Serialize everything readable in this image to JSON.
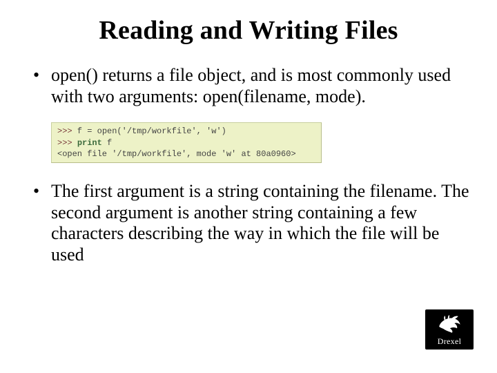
{
  "title": "Reading and Writing Files",
  "bullets": {
    "b1": "open() returns a file object, and is most commonly used with two arguments: open(filename, mode).",
    "b2": "The first argument is a string containing the filename. The second argument is another string containing a few characters describing the way in which the file will be used"
  },
  "code": {
    "prompt": ">>>",
    "line1_rest": " f = open('/tmp/workfile', 'w')",
    "line2_kw": "print",
    "line2_rest": " f",
    "line3": "<open file '/tmp/workfile', mode 'w' at 80a0960>"
  },
  "logo_text": "Drexel"
}
